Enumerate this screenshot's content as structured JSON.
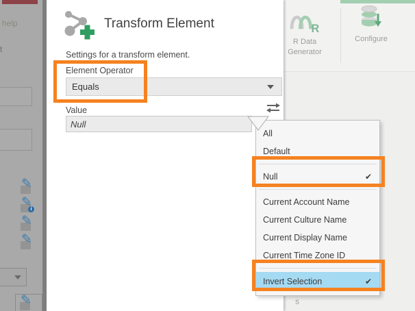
{
  "dialog": {
    "title": "Transform Element",
    "subtitle": "Settings for a transform element.",
    "operator_label": "Element Operator",
    "operator_value": "Equals",
    "value_label": "Value",
    "value_text": "Null"
  },
  "ribbon": {
    "r_data_generator_label_line1": "R Data",
    "r_data_generator_label_line2": "Generator",
    "configure_label": "Configure"
  },
  "menu": {
    "items": [
      {
        "label": "All",
        "checked": false
      },
      {
        "label": "Default",
        "checked": false
      },
      {
        "label": "Null",
        "checked": true
      },
      {
        "label": "Current Account Name",
        "checked": false
      },
      {
        "label": "Current Culture Name",
        "checked": false
      },
      {
        "label": "Current Display Name",
        "checked": false
      },
      {
        "label": "Current Time Zone ID",
        "checked": false
      },
      {
        "label": "Invert Selection",
        "checked": true
      }
    ]
  },
  "background": {
    "help_text": "help",
    "partial_text_left": "t",
    "partial_text_bottom": "s"
  },
  "colors": {
    "annotation_orange": "#f58220",
    "selection_blue": "#a5daf3",
    "accent_green": "#2f9e63",
    "ribbon_green": "#a3cfb1",
    "overlay_gray": "#a9a9a9"
  }
}
